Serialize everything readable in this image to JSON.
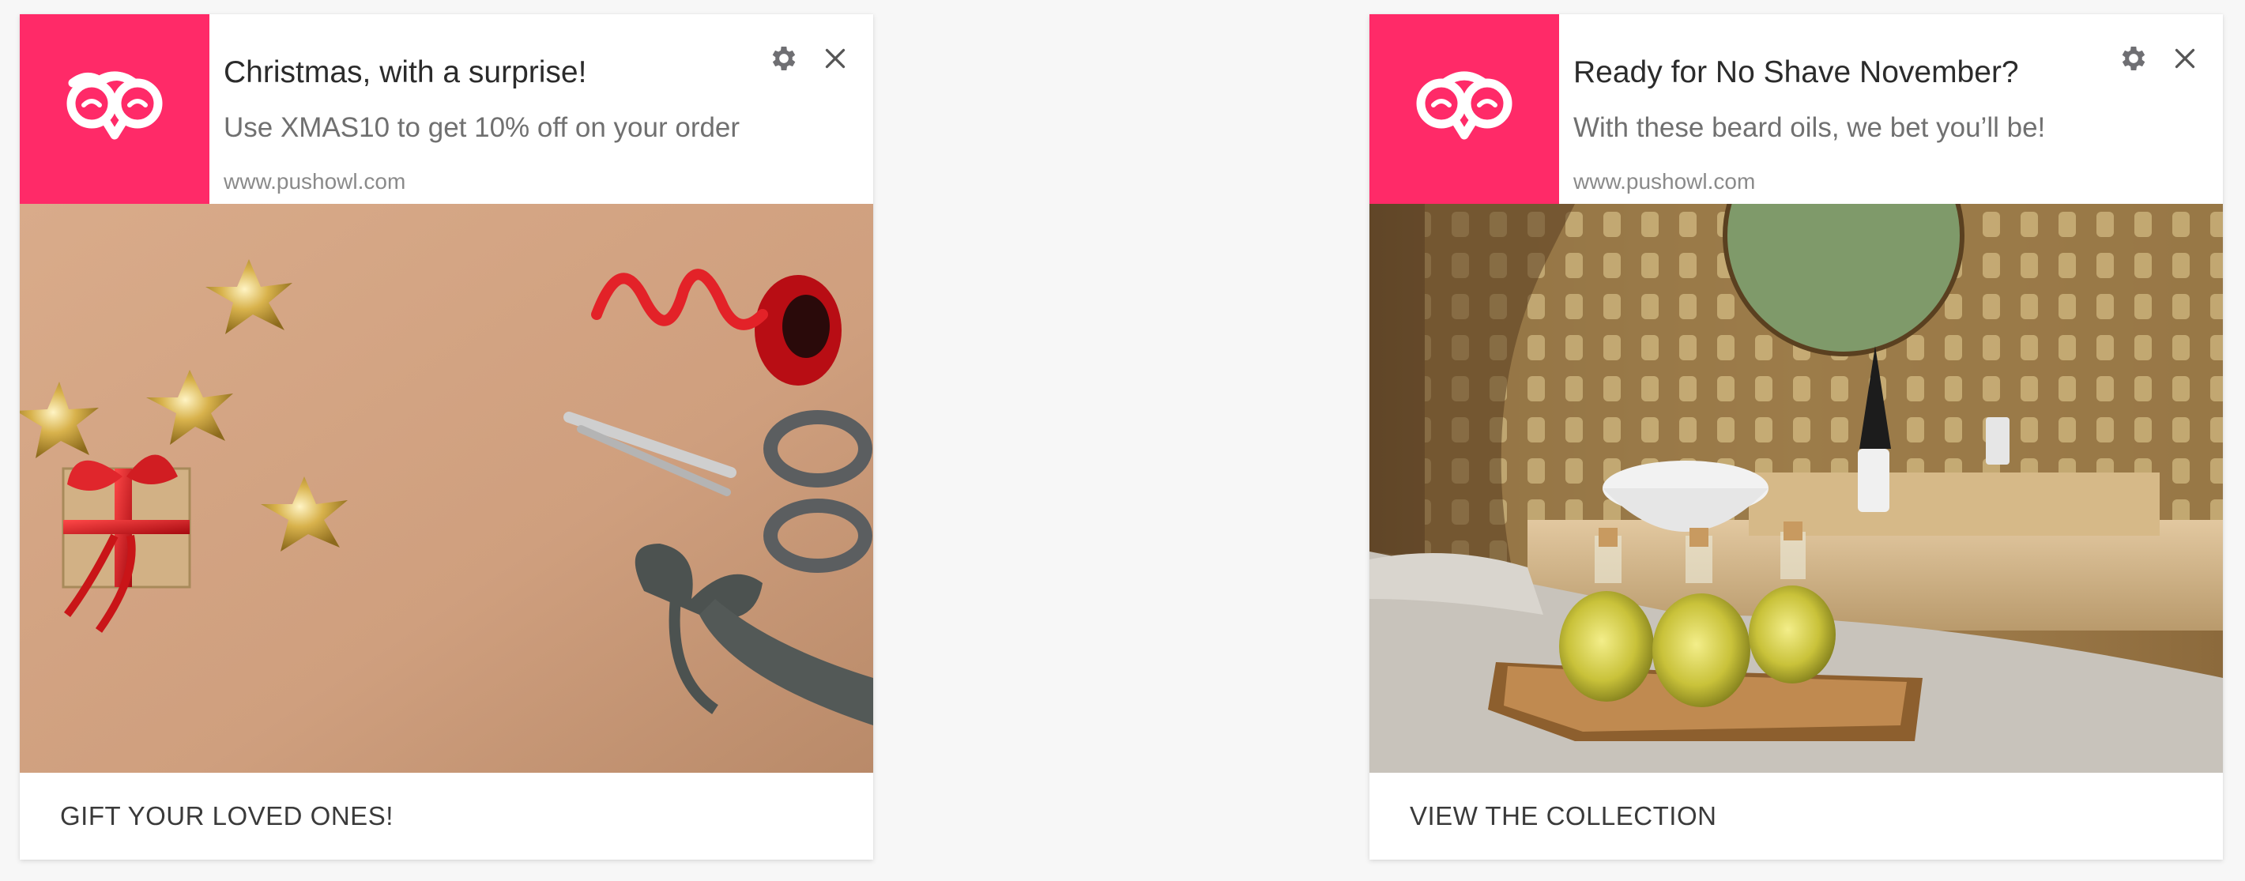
{
  "colors": {
    "brand": "#ff2a68",
    "page_background": "#f7f7f7",
    "card_background": "#ffffff",
    "title_text": "#2b2b2b",
    "body_text": "#707070"
  },
  "notifications": [
    {
      "logo_icon": "pushowl-owl-icon",
      "title": "Christmas, with a surprise!",
      "message": "Use XMAS10 to get 10% off on your order",
      "site": "www.pushowl.com",
      "settings_icon": "gear-icon",
      "close_icon": "close-icon",
      "hero_image": "christmas-wrapping-supplies-image",
      "action_label": "GIFT YOUR LOVED ONES!"
    },
    {
      "logo_icon": "pushowl-owl-icon",
      "title": "Ready for No Shave November?",
      "message": "With these beard oils, we bet you’ll be!",
      "site": "www.pushowl.com",
      "settings_icon": "gear-icon",
      "close_icon": "close-icon",
      "hero_image": "beard-oil-bottles-spa-image",
      "action_label": "VIEW THE COLLECTION"
    }
  ]
}
